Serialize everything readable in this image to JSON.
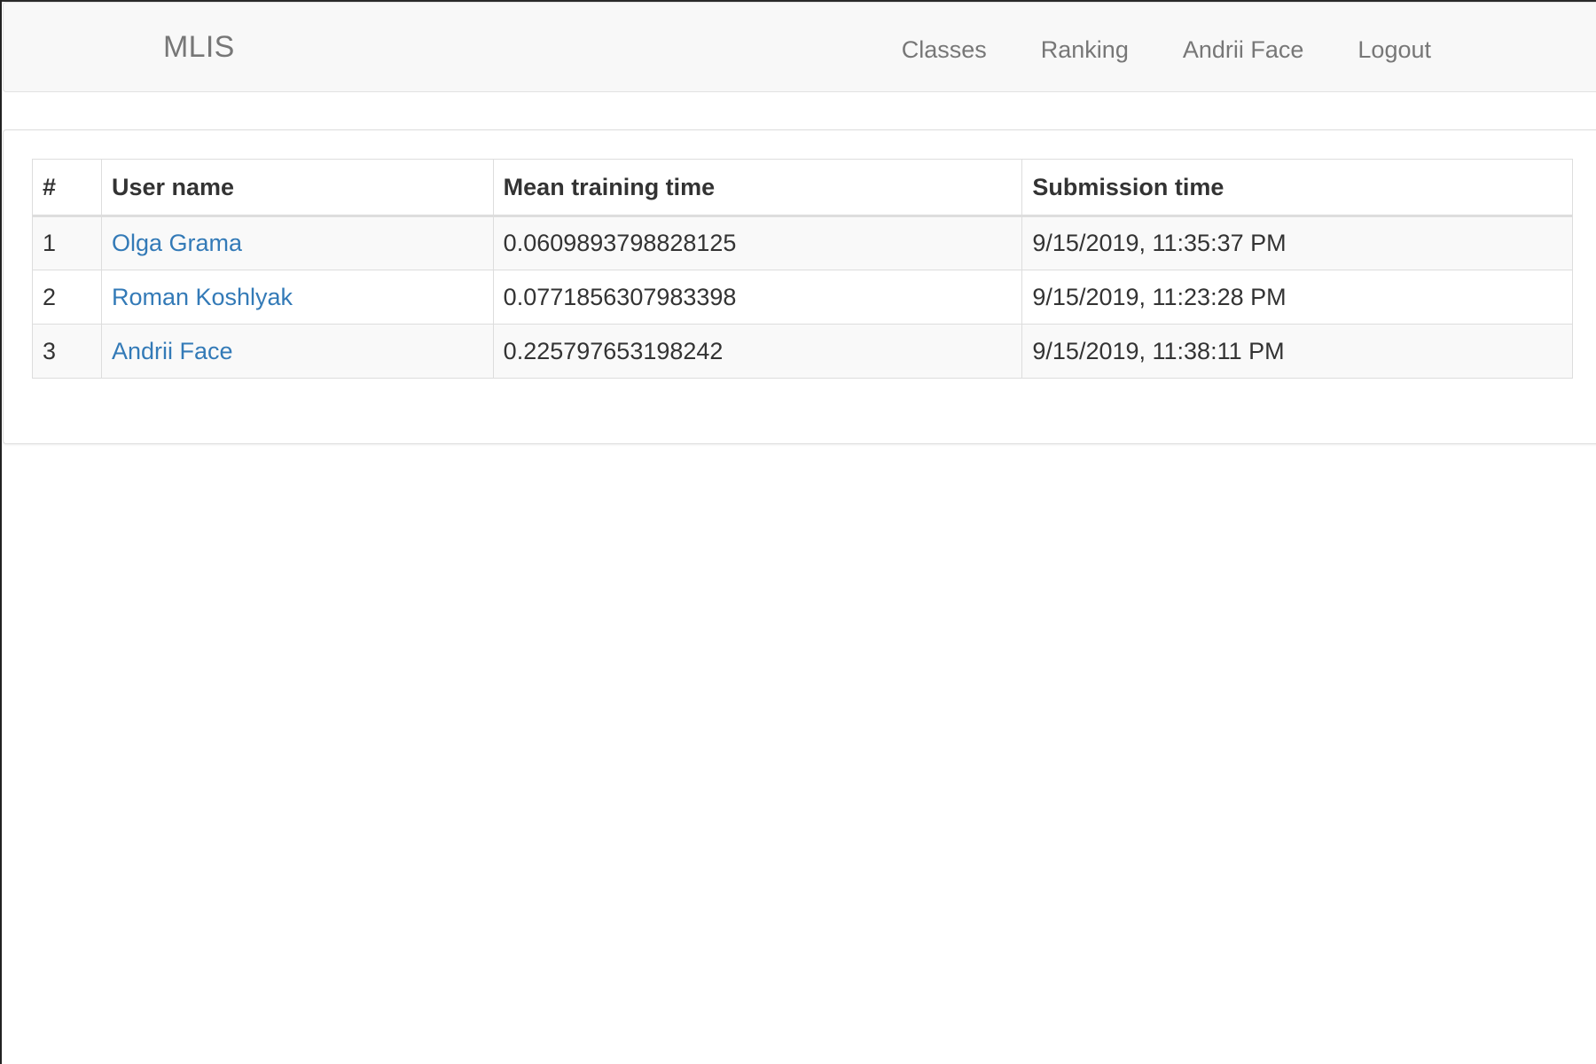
{
  "navbar": {
    "brand": "MLIS",
    "links": [
      "Classes",
      "Ranking",
      "Andrii Face",
      "Logout"
    ]
  },
  "table": {
    "headers": [
      "#",
      "User name",
      "Mean training time",
      "Submission time"
    ],
    "rows": [
      {
        "rank": "1",
        "user": "Olga Grama",
        "mean_training_time": "0.0609893798828125",
        "submission_time": "9/15/2019, 11:35:37 PM"
      },
      {
        "rank": "2",
        "user": "Roman Koshlyak",
        "mean_training_time": "0.0771856307983398",
        "submission_time": "9/15/2019, 11:23:28 PM"
      },
      {
        "rank": "3",
        "user": "Andrii Face",
        "mean_training_time": "0.225797653198242",
        "submission_time": "9/15/2019, 11:38:11 PM"
      }
    ]
  },
  "colors": {
    "link": "#337ab7",
    "nav_text": "#777777",
    "navbar_bg": "#f8f8f8",
    "stripe_bg": "#f9f9f9"
  }
}
